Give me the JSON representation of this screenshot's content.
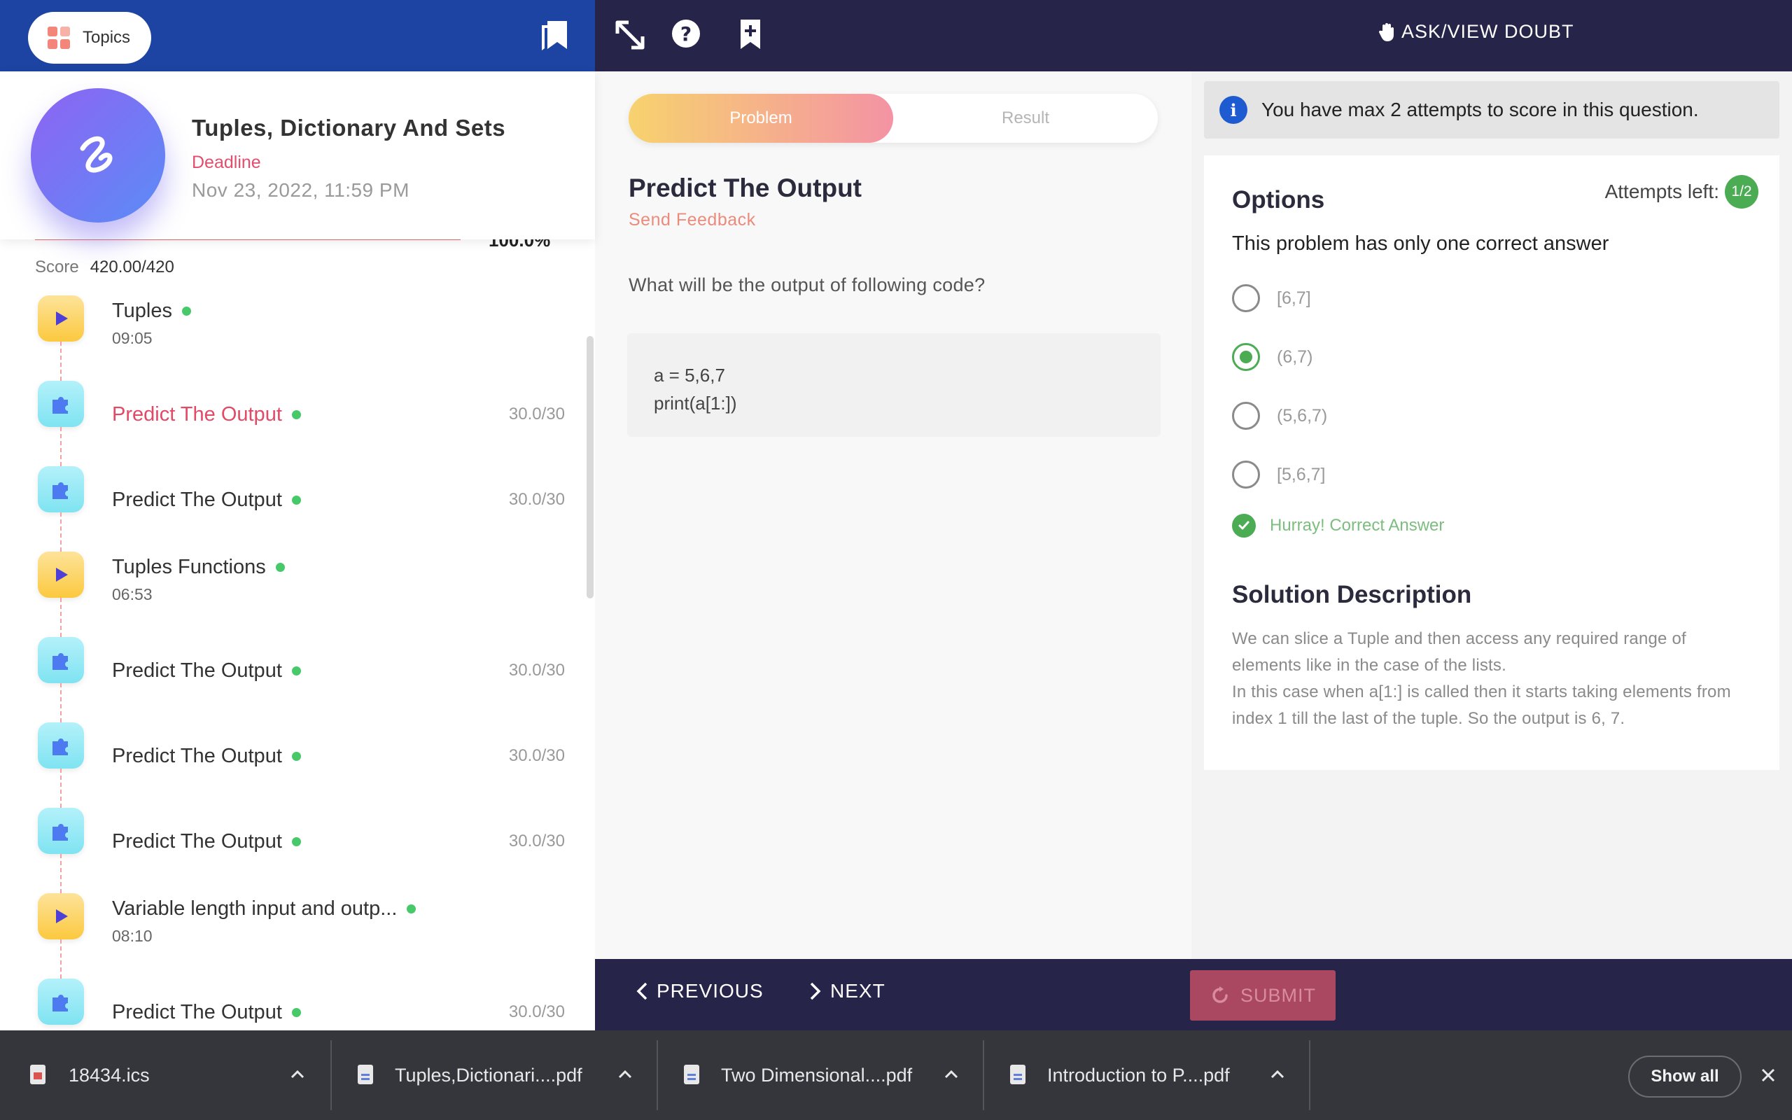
{
  "header": {
    "topics_label": "Topics",
    "ask_doubt_label": "ASK/VIEW DOUBT"
  },
  "topic": {
    "title": "Tuples, Dictionary And Sets",
    "deadline_label": "Deadline",
    "deadline_date": "Nov 23, 2022, 11:59 PM",
    "progress_text": "100.0%",
    "progress": 1.0,
    "score_label": "Score",
    "score_value": "420.00/420"
  },
  "items": [
    {
      "type": "video",
      "title": "Tuples",
      "duration": "09:05"
    },
    {
      "type": "problem",
      "title": "Predict The Output",
      "score": "30.0/30",
      "active": true
    },
    {
      "type": "problem",
      "title": "Predict The Output",
      "score": "30.0/30"
    },
    {
      "type": "video",
      "title": "Tuples Functions",
      "duration": "06:53"
    },
    {
      "type": "problem",
      "title": "Predict The Output",
      "score": "30.0/30"
    },
    {
      "type": "problem",
      "title": "Predict The Output",
      "score": "30.0/30"
    },
    {
      "type": "problem",
      "title": "Predict The Output",
      "score": "30.0/30"
    },
    {
      "type": "video",
      "title": "Variable length input and outp...",
      "duration": "08:10"
    },
    {
      "type": "problem",
      "title": "Predict The Output",
      "score": "30.0/30"
    }
  ],
  "tabs": {
    "problem": "Problem",
    "result": "Result"
  },
  "question": {
    "title": "Predict The Output",
    "feedback": "Send Feedback",
    "text": "What will be the output of following code?",
    "code_line1": "a = 5,6,7",
    "code_line2": "print(a[1:])"
  },
  "answer": {
    "banner": "You have max 2 attempts to score in this question.",
    "options_title": "Options",
    "attempts_label": "Attempts left:",
    "attempts_value": "1/2",
    "subtitle": "This problem has only one correct answer",
    "options": [
      "[6,7]",
      "(6,7)",
      "(5,6,7)",
      "[5,6,7]"
    ],
    "selected_index": 1,
    "result_text": "Hurray! Correct Answer",
    "solution_title": "Solution Description",
    "solution_p1": "We can slice a Tuple and then access any required range of elements like in the case of the lists.",
    "solution_p2": "In this case when a[1:] is called then it starts taking elements from index 1 till the last of the tuple. So the output is 6, 7."
  },
  "nav": {
    "previous": "PREVIOUS",
    "next": "NEXT",
    "submit": "SUBMIT"
  },
  "downloads": {
    "files": [
      "18434.ics",
      "Tuples,Dictionari....pdf",
      "Two Dimensional....pdf",
      "Introduction to P....pdf"
    ],
    "show_all": "Show all"
  },
  "colors": {
    "left_header": "#1d44a2",
    "dark_bar": "#27244a",
    "accent_red": "#e24a66",
    "success_green": "#4bac54"
  }
}
